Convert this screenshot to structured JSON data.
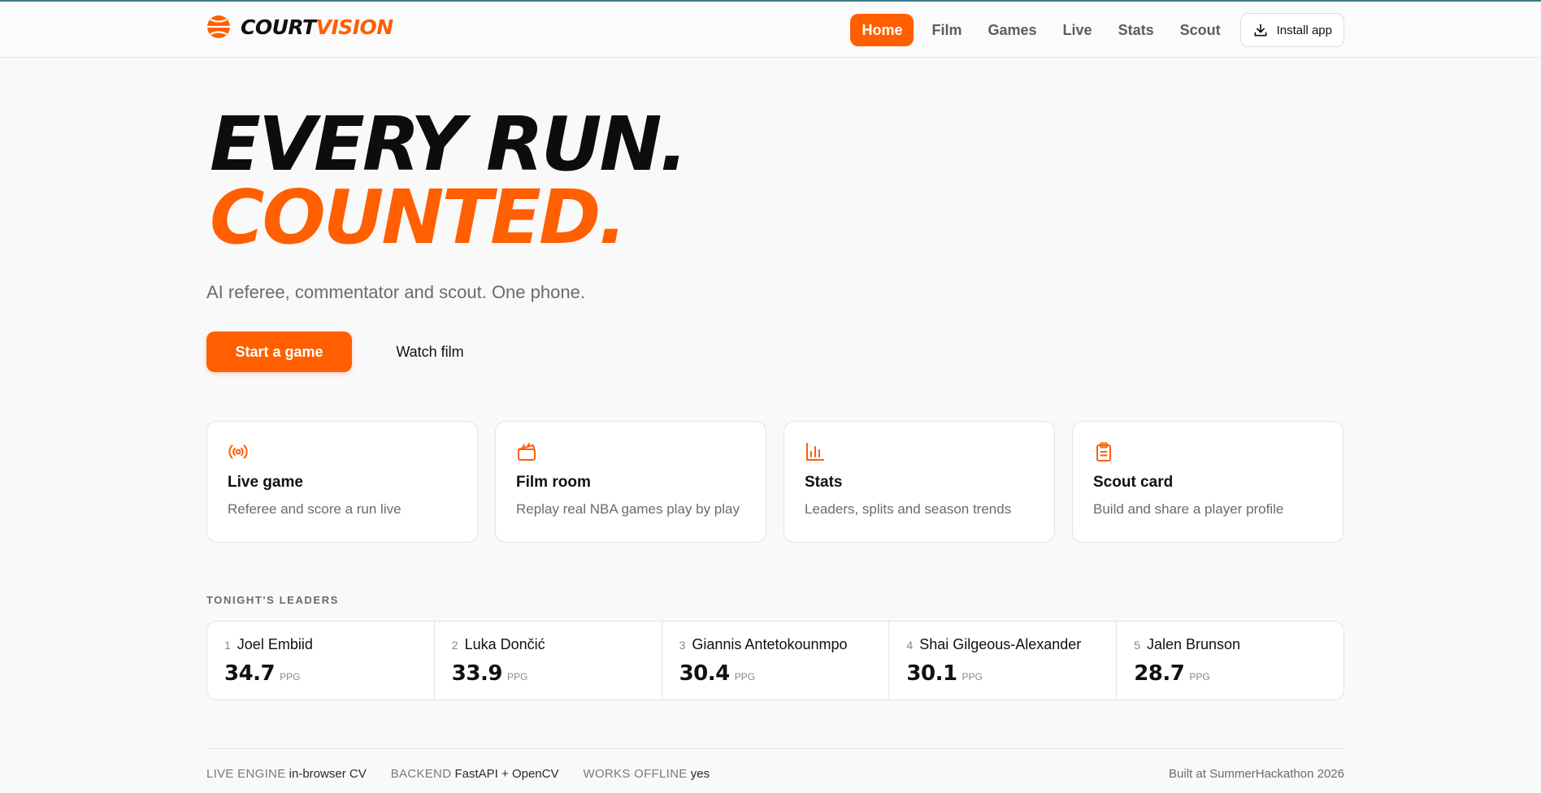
{
  "brand": {
    "part1": "COURT",
    "part2": "VISION",
    "accent_color": "#ff5f00"
  },
  "nav": {
    "items": [
      {
        "label": "Home",
        "active": true
      },
      {
        "label": "Film",
        "active": false
      },
      {
        "label": "Games",
        "active": false
      },
      {
        "label": "Live",
        "active": false
      },
      {
        "label": "Stats",
        "active": false
      },
      {
        "label": "Scout",
        "active": false
      }
    ],
    "install_label": "Install app",
    "install_icon": "download-icon"
  },
  "hero": {
    "line1": "EVERY RUN.",
    "line2": "COUNTED.",
    "subtitle": "AI referee, commentator and scout. One phone.",
    "primary_cta": "Start a game",
    "secondary_cta": "Watch film"
  },
  "cards": [
    {
      "icon": "broadcast-icon",
      "title": "Live game",
      "desc": "Referee and score a run live"
    },
    {
      "icon": "clapperboard-icon",
      "title": "Film room",
      "desc": "Replay real NBA games play by play"
    },
    {
      "icon": "bar-chart-icon",
      "title": "Stats",
      "desc": "Leaders, splits and season trends"
    },
    {
      "icon": "clipboard-icon",
      "title": "Scout card",
      "desc": "Build and share a player profile"
    }
  ],
  "leaders": {
    "label": "TONIGHT'S LEADERS",
    "items": [
      {
        "rank": "1",
        "name": "Joel Embiid",
        "value": "34.7",
        "unit": "PPG"
      },
      {
        "rank": "2",
        "name": "Luka Dončić",
        "value": "33.9",
        "unit": "PPG"
      },
      {
        "rank": "3",
        "name": "Giannis Antetokounmpo",
        "value": "30.4",
        "unit": "PPG"
      },
      {
        "rank": "4",
        "name": "Shai Gilgeous-Alexander",
        "value": "30.1",
        "unit": "PPG"
      },
      {
        "rank": "5",
        "name": "Jalen Brunson",
        "value": "28.7",
        "unit": "PPG"
      }
    ]
  },
  "footer": {
    "meta": [
      {
        "key": "LIVE ENGINE",
        "value": "in-browser CV"
      },
      {
        "key": "BACKEND",
        "value": "FastAPI + OpenCV"
      },
      {
        "key": "WORKS OFFLINE",
        "value": "yes"
      }
    ],
    "credit": "Built at SummerHackathon 2026"
  }
}
